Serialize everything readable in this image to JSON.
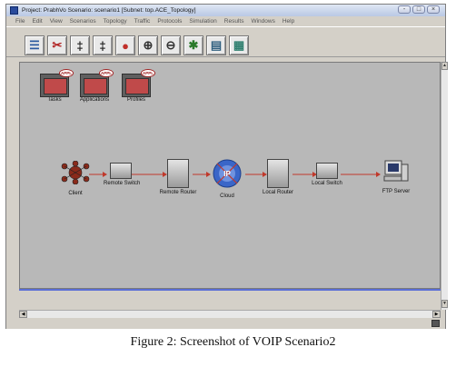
{
  "window": {
    "title": "Project: PrabhVo Scenario: scenario1  [Subnet: top.ACE_Topology]",
    "buttons": [
      "-",
      "□",
      "×"
    ]
  },
  "menu": [
    "File",
    "Edit",
    "View",
    "Scenarios",
    "Topology",
    "Traffic",
    "Protocols",
    "Simulation",
    "Results",
    "Windows",
    "Help"
  ],
  "toolbar": {
    "icons": [
      "object-palette-icon",
      "cut-icon",
      "link-icon",
      "link-icon-2",
      "fail-node-icon",
      "zoom-in-icon",
      "zoom-out-icon",
      "run-simulation-icon",
      "view-results-icon",
      "view-web-report-icon"
    ],
    "glyphs": [
      "☰",
      "✂",
      "‡",
      "‡",
      "●",
      "⊕",
      "⊖",
      "✱",
      "▤",
      "▦"
    ]
  },
  "palettes": [
    {
      "label": "Tasks",
      "badge": "APPL"
    },
    {
      "label": "Applications",
      "badge": "APPL"
    },
    {
      "label": "Profiles",
      "badge": "APPL"
    }
  ],
  "nodes": [
    {
      "label": "Client"
    },
    {
      "label": "Remote Switch"
    },
    {
      "label": "Remote Router"
    },
    {
      "label": "Cloud",
      "badge": "IP"
    },
    {
      "label": "Local Router"
    },
    {
      "label": "Local Switch"
    },
    {
      "label": "FTP Server"
    }
  ],
  "caption": "Figure 2: Screenshot of VOIP Scenario2"
}
